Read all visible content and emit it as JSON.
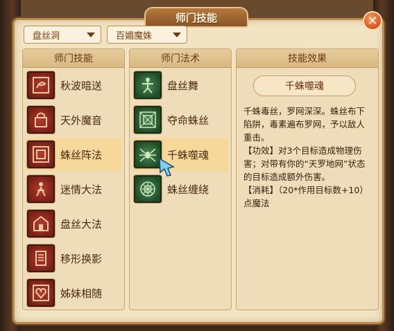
{
  "window": {
    "title": "师门技能"
  },
  "filters": {
    "school": "盘丝洞",
    "character": "百媚魔姝"
  },
  "columns": {
    "skills_header": "师门技能",
    "spells_header": "师门法术",
    "effect_header": "技能效果"
  },
  "skills": [
    {
      "label": "秋波暗送",
      "icon": "swirl-icon"
    },
    {
      "label": "天外魔音",
      "icon": "lock-icon"
    },
    {
      "label": "蛛丝阵法",
      "icon": "square-frame-icon",
      "selected": true
    },
    {
      "label": "迷情大法",
      "icon": "figure-icon"
    },
    {
      "label": "盘丝大法",
      "icon": "house-icon"
    },
    {
      "label": "移形换影",
      "icon": "scroll-icon"
    },
    {
      "label": "姊妹相随",
      "icon": "heart-icon"
    }
  ],
  "spells": [
    {
      "label": "盘丝舞",
      "icon": "dancer-icon"
    },
    {
      "label": "夺命蛛丝",
      "icon": "web-square-icon"
    },
    {
      "label": "千蛛噬魂",
      "icon": "spider-icon",
      "selected": true
    },
    {
      "label": "蛛丝缠绕",
      "icon": "web-icon"
    }
  ],
  "effect": {
    "title": "千蛛噬魂",
    "desc": "千蛛毒丝，罗网深深。蛛丝布下陷阱，毒素遍布罗网，予以敌人重击。",
    "effect_line": "【功效】对3个目标造成物理伤害；对带有你的“天罗地网”状态的目标造成额外伤害。",
    "cost_line": "【消耗】（20*作用目标数+10）点魔法"
  },
  "colors": {
    "panel": "#f2e3c3",
    "selected_row": "#f6d89a",
    "title_tab": "#8a5426",
    "close": "#d8531e"
  }
}
